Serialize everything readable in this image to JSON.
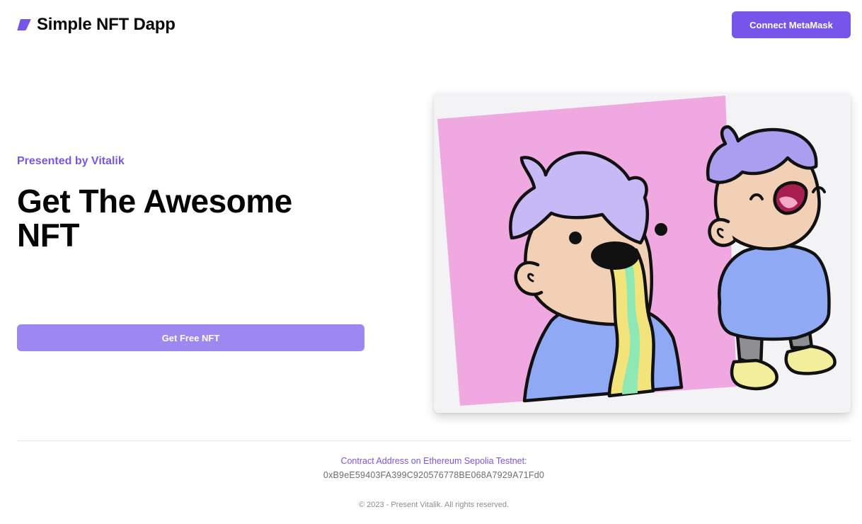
{
  "header": {
    "brand_icon": "tag-icon",
    "brand_title": "Simple NFT Dapp",
    "connect_label": "Connect MetaMask"
  },
  "hero": {
    "eyebrow": "Presented by Vitalik",
    "title": "Get The Awesome NFT",
    "mint_label": "Get Free NFT"
  },
  "artwork": {
    "icon": "nft-artwork-illustration"
  },
  "footer": {
    "contract_label": "Contract Address on Ethereum Sepolia Testnet:",
    "contract_address": "0xB9eE59403FA399C920576778BE068A7929A71Fd0",
    "copyright": "© 2023 - Present Vitalik. All rights reserved."
  },
  "colors": {
    "accent": "#7656ea",
    "accent_light": "#9d87f1",
    "eyebrow": "#7a55e8",
    "art_pink": "#f0a9e0",
    "art_lavender": "#c6b9f6",
    "art_blue": "#90a9f5",
    "art_skin": "#f2d0b6"
  }
}
